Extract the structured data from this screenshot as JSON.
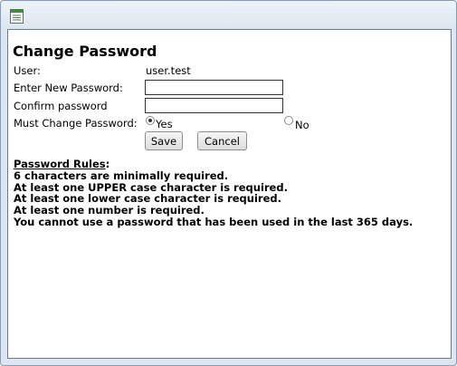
{
  "dialog": {
    "title": "Change Password"
  },
  "form": {
    "user_label": "User:",
    "user_value": "user.test",
    "new_password_label": "Enter New Password:",
    "new_password_value": "",
    "confirm_password_label": "Confirm password",
    "confirm_password_value": "",
    "must_change_label": "Must Change Password:",
    "must_change_options": [
      {
        "label": "Yes",
        "selected": true
      },
      {
        "label": "No",
        "selected": false
      }
    ],
    "save_label": "Save",
    "cancel_label": "Cancel"
  },
  "rules": {
    "heading": "Password Rules",
    "heading_suffix": ":",
    "items": [
      "6 characters are minimally required.",
      "At least one UPPER case character is required.",
      "At least one lower case character is required.",
      "At least one number is required.",
      "You cannot use a password that has been used in the last 365 days."
    ]
  },
  "icons": {
    "window_icon": "document-list-icon"
  },
  "colors": {
    "window_frame": "#dde6f0",
    "window_icon_green": "#3c8f3c"
  }
}
